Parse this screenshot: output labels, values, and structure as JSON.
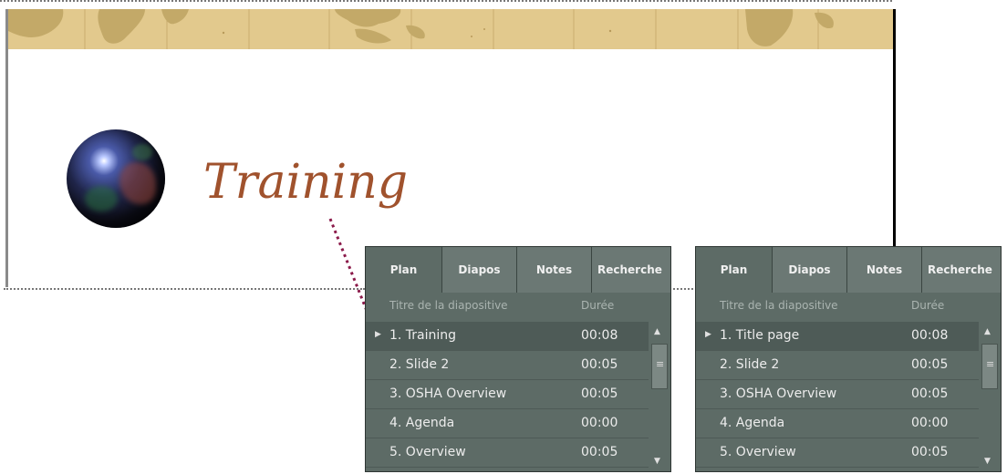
{
  "slide": {
    "title": "Training"
  },
  "panels": [
    {
      "tabs": [
        "Plan",
        "Diapos",
        "Notes",
        "Recherche"
      ],
      "active_tab": "Plan",
      "columns": {
        "title": "Titre de la diapositive",
        "duration": "Durée"
      },
      "rows": [
        {
          "title": "1. Training",
          "duration": "00:08",
          "selected": true
        },
        {
          "title": "2. Slide 2",
          "duration": "00:05"
        },
        {
          "title": "3. OSHA Overview",
          "duration": "00:05"
        },
        {
          "title": "4. Agenda",
          "duration": "00:00"
        },
        {
          "title": "5. Overview",
          "duration": "00:05"
        }
      ]
    },
    {
      "tabs": [
        "Plan",
        "Diapos",
        "Notes",
        "Recherche"
      ],
      "active_tab": "Plan",
      "columns": {
        "title": "Titre de la diapositive",
        "duration": "Durée"
      },
      "rows": [
        {
          "title": "1. Title page",
          "duration": "00:08",
          "selected": true
        },
        {
          "title": "2. Slide 2",
          "duration": "00:05"
        },
        {
          "title": "3. OSHA Overview",
          "duration": "00:05"
        },
        {
          "title": "4. Agenda",
          "duration": "00:00"
        },
        {
          "title": "5. Overview",
          "duration": "00:05"
        }
      ]
    }
  ],
  "icons": {
    "row_arrow": "triangle-right-icon",
    "scroll_up": "triangle-up-icon",
    "scroll_down": "triangle-down-icon",
    "scroll_grip": "grip-icon"
  },
  "colors": {
    "banner": "#e2c98d",
    "title_text": "#a0522d",
    "panel_bg": "#5d6b66",
    "selected_row": "#4e5b57",
    "pointer": "#8b1a4a"
  }
}
